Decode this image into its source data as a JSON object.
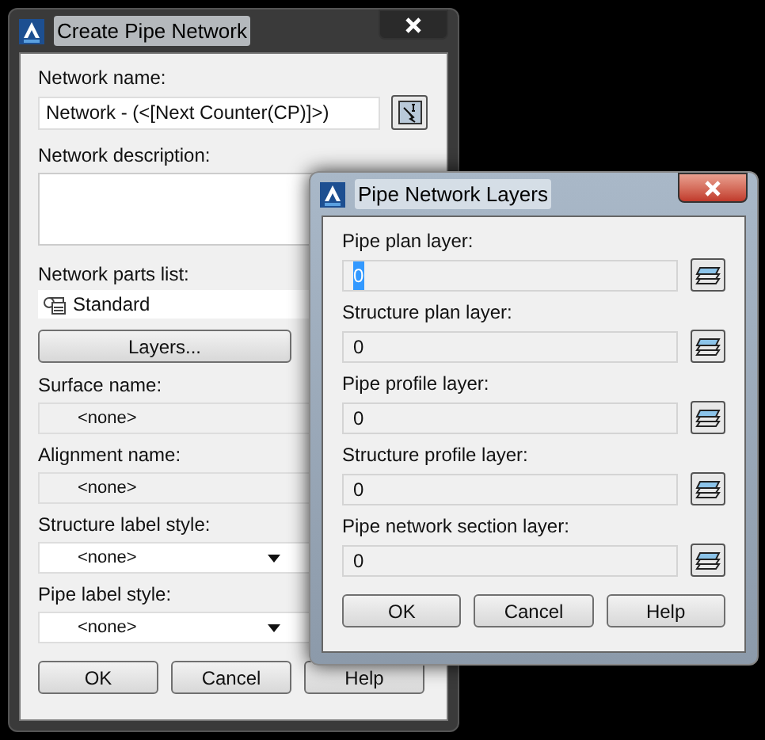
{
  "main_dialog": {
    "title": "Create Pipe Network",
    "active": false,
    "fields": [
      {
        "kind": "text",
        "label": "Network name:",
        "value": "Network - (<[Next Counter(CP)]>)"
      },
      {
        "kind": "textarea",
        "label": "Network description:"
      },
      {
        "kind": "parts",
        "label": "Network parts list:",
        "value": "Standard"
      },
      {
        "kind": "button",
        "value": "Layers..."
      },
      {
        "kind": "readonly",
        "label": "Surface name:",
        "value": "<none>"
      },
      {
        "kind": "readonly",
        "label": "Alignment name:",
        "value": "<none>"
      },
      {
        "kind": "dropdown",
        "label": "Structure label style:",
        "value": "<none>"
      },
      {
        "kind": "dropdown",
        "label": "Pipe label style:",
        "value": "<none>"
      }
    ],
    "buttons": [
      "OK",
      "Cancel",
      "Help"
    ]
  },
  "layers_dialog": {
    "title": "Pipe Network Layers",
    "active": true,
    "fields": [
      {
        "label": "Pipe plan layer:",
        "value": "0",
        "highlighted": true
      },
      {
        "label": "Structure plan layer:",
        "value": "0",
        "highlighted": false
      },
      {
        "label": "Pipe profile layer:",
        "value": "0",
        "highlighted": false
      },
      {
        "label": "Structure profile layer:",
        "value": "0",
        "highlighted": false
      },
      {
        "label": "Pipe network section layer:",
        "value": "0",
        "highlighted": false
      }
    ],
    "buttons": [
      "OK",
      "Cancel",
      "Help"
    ]
  }
}
